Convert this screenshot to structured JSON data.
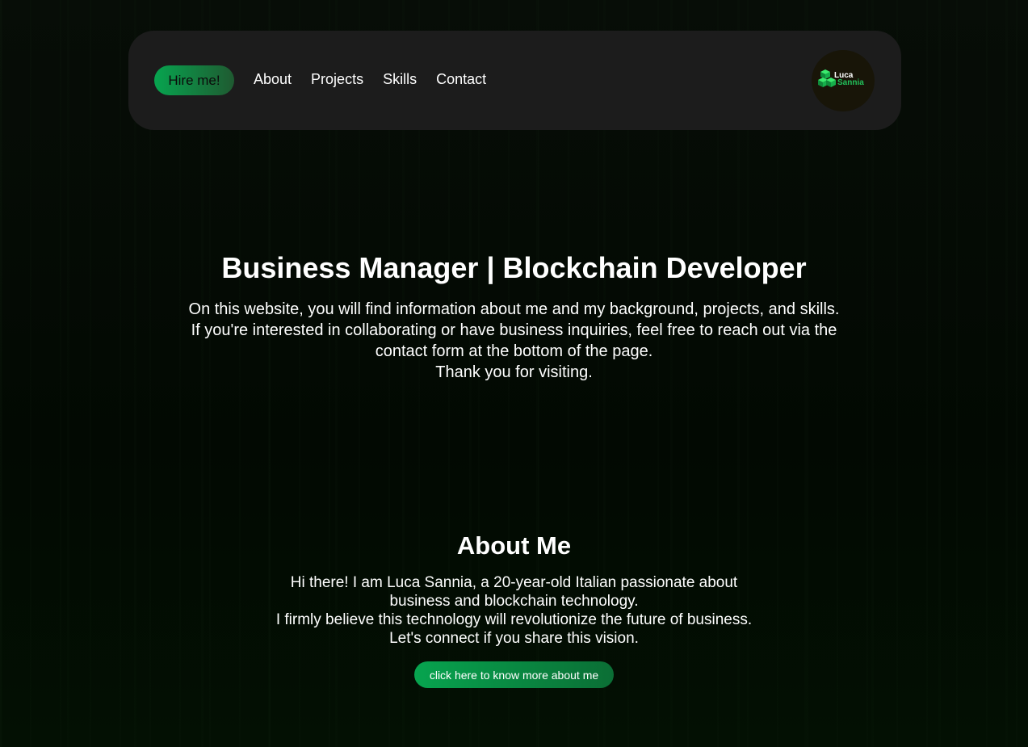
{
  "nav": {
    "hire_label": "Hire me!",
    "links": [
      "About",
      "Projects",
      "Skills",
      "Contact"
    ],
    "logo": {
      "line1": "Luca",
      "line2": "Sannia",
      "icon": "cubes-logo-icon"
    }
  },
  "hero": {
    "title": "Business Manager | Blockchain Developer",
    "lines": [
      "On this website, you will find information about me and my background, projects, and skills.",
      "If you're interested in collaborating or have business inquiries, feel free to reach out via the",
      "contact form at the bottom of the page.",
      "Thank you for visiting."
    ]
  },
  "about": {
    "title": "About Me",
    "lines": [
      "Hi there! I am Luca Sannia, a 20-year-old Italian passionate about",
      "business and blockchain technology.",
      "I firmly believe this technology will revolutionize the future of business.",
      "Let's connect if you share this vision."
    ],
    "button_label": "click here to know more about me"
  },
  "colors": {
    "accent": "#07a44f",
    "background": "#030a03",
    "navbar": "#1c1c1c"
  }
}
